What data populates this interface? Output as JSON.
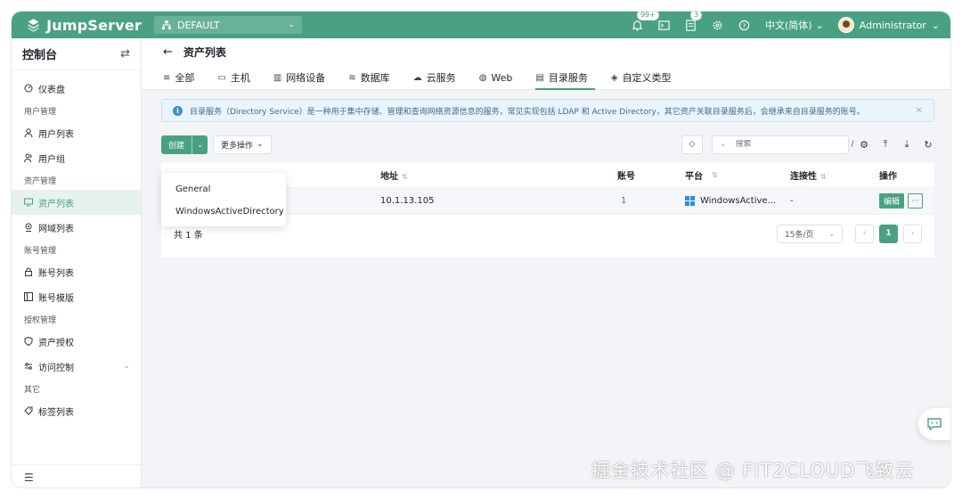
{
  "header": {
    "brand": "JumpServer",
    "org": "DEFAULT",
    "notifications_badge": "99+",
    "tickets_badge": "3",
    "language": "中文(简体)",
    "user": "Administrator",
    "accent_color": "#4aa181"
  },
  "sidebar": {
    "title": "控制台",
    "items": [
      {
        "type": "item",
        "label": "仪表盘",
        "icon": "dashboard-icon"
      },
      {
        "type": "group",
        "label": "用户管理"
      },
      {
        "type": "item",
        "label": "用户列表",
        "icon": "user-icon"
      },
      {
        "type": "item",
        "label": "用户组",
        "icon": "user-group-icon"
      },
      {
        "type": "group",
        "label": "资产管理"
      },
      {
        "type": "item",
        "label": "资产列表",
        "icon": "asset-list-icon",
        "active": true
      },
      {
        "type": "item",
        "label": "网域列表",
        "icon": "domain-icon"
      },
      {
        "type": "group",
        "label": "账号管理"
      },
      {
        "type": "item",
        "label": "账号列表",
        "icon": "lock-icon"
      },
      {
        "type": "item",
        "label": "账号模版",
        "icon": "template-icon"
      },
      {
        "type": "group",
        "label": "授权管理"
      },
      {
        "type": "item",
        "label": "资产授权",
        "icon": "shield-icon"
      },
      {
        "type": "item",
        "label": "访问控制",
        "icon": "access-control-icon"
      },
      {
        "type": "group",
        "label": "其它"
      },
      {
        "type": "item",
        "label": "标签列表",
        "icon": "tag-icon"
      }
    ]
  },
  "page": {
    "title": "资产列表",
    "tabs": [
      {
        "label": "全部",
        "icon": "≡"
      },
      {
        "label": "主机",
        "icon": "▭"
      },
      {
        "label": "网络设备",
        "icon": "▥"
      },
      {
        "label": "数据库",
        "icon": "≋"
      },
      {
        "label": "云服务",
        "icon": "☁"
      },
      {
        "label": "Web",
        "icon": "◍"
      },
      {
        "label": "目录服务",
        "icon": "▤",
        "active": true
      },
      {
        "label": "自定义类型",
        "icon": "◈"
      }
    ],
    "info": "目录服务（Directory Service）是一种用于集中存储、管理和查询网络资源信息的服务，常见实现包括 LDAP 和 Active Directory，其它资产关联目录服务后，会继承来自目录服务的账号。"
  },
  "toolbar": {
    "create_label": "创建",
    "more_label": "更多操作",
    "search_placeholder": "搜索",
    "create_options": [
      "General",
      "WindowsActiveDirectory"
    ]
  },
  "table": {
    "columns": [
      "地址",
      "账号",
      "平台",
      "连接性",
      "操作"
    ],
    "rows": [
      {
        "address": "10.1.13.105",
        "accounts": "1",
        "platform": "WindowsActive...",
        "connectivity": "-",
        "edit": "编辑",
        "more": "···"
      }
    ],
    "total": "共 1 条",
    "page_size": "15条/页",
    "current_page": "1"
  },
  "watermark": "掘金技术社区 @ FIT2CLOUD飞致云"
}
